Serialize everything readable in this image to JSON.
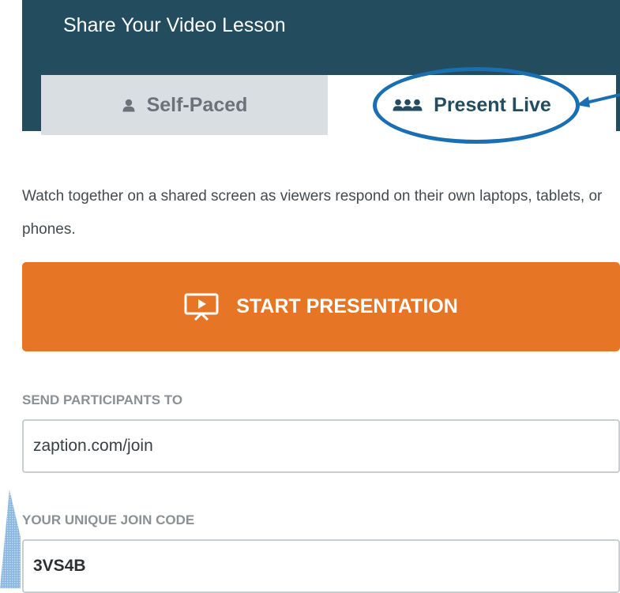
{
  "header": {
    "title": "Share Your Video Lesson",
    "tabs": [
      {
        "label": "Self-Paced",
        "icon": "user-icon",
        "active": false
      },
      {
        "label": "Present Live",
        "icon": "group-icon",
        "active": true
      }
    ]
  },
  "description": "Watch together on a shared screen as viewers respond on their own laptops, tablets, or phones.",
  "start_button": {
    "label": "START PRESENTATION",
    "icon": "presentation-screen-icon"
  },
  "send_participants": {
    "label": "SEND PARTICIPANTS TO",
    "value": "zaption.com/join"
  },
  "join_code": {
    "label": "YOUR UNIQUE JOIN CODE",
    "value": "3VS4B"
  },
  "colors": {
    "header_bg": "#234d5e",
    "accent_orange": "#e67626",
    "annotation_blue": "#1a6fb2",
    "inactive_tab_bg": "#d8dee1"
  }
}
